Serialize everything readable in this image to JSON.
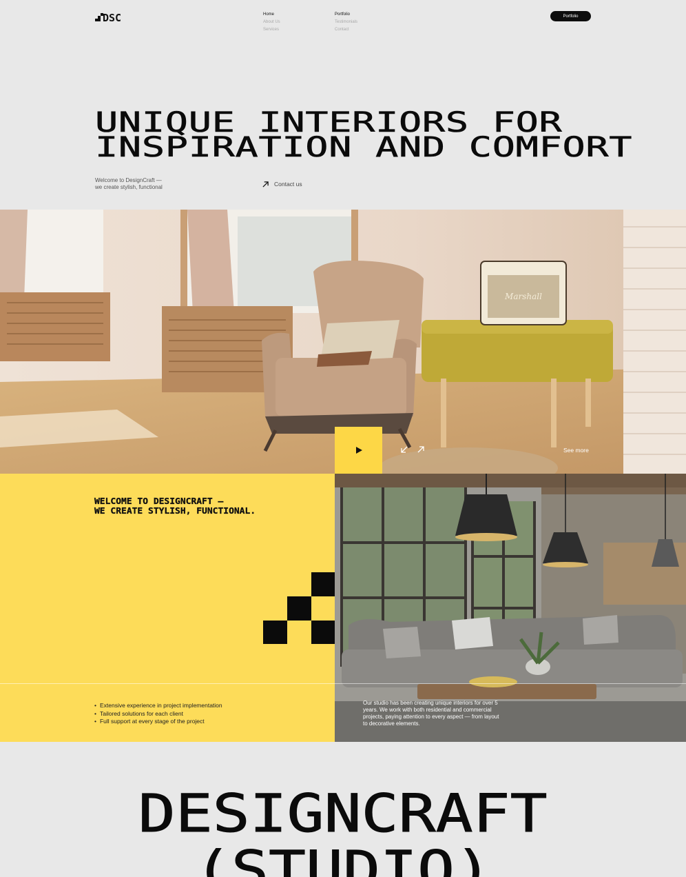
{
  "brand": {
    "logo_text": "DSC"
  },
  "nav": {
    "col1": [
      "Home",
      "About Us",
      "Services"
    ],
    "col2": [
      "Portfolio",
      "Testimonials",
      "Contact"
    ]
  },
  "header": {
    "portfolio_button": "Portfolio"
  },
  "hero": {
    "title_line1": "UNIQUE INTERIORS FOR",
    "title_line2": "INSPIRATION AND COMFORT",
    "subtitle_line1": "Welcome to DesignCraft —",
    "subtitle_line2": "we create stylish, functional",
    "contact_label": "Contact us"
  },
  "gallery": {
    "see_more": "See more",
    "radio_brand": "Marshall"
  },
  "about": {
    "title_line1": "WELCOME TO DESIGNCRAFT —",
    "title_line2": "WE CREATE STYLISH, FUNCTIONAL.",
    "features": [
      "Extensive experience in project implementation",
      "Tailored solutions for each client",
      "Full support at every stage of the project"
    ],
    "description": "Our studio has been creating unique interiors for over 5 years. We work with both residential and commercial projects, paying attention to every aspect — from layout to decorative elements."
  },
  "bottom": {
    "line1": "DESIGNCRAFT",
    "line2": "(STUDIO)"
  },
  "colors": {
    "accent": "#fdd746",
    "background": "#e8e8e8",
    "dark": "#0d0d0d"
  }
}
